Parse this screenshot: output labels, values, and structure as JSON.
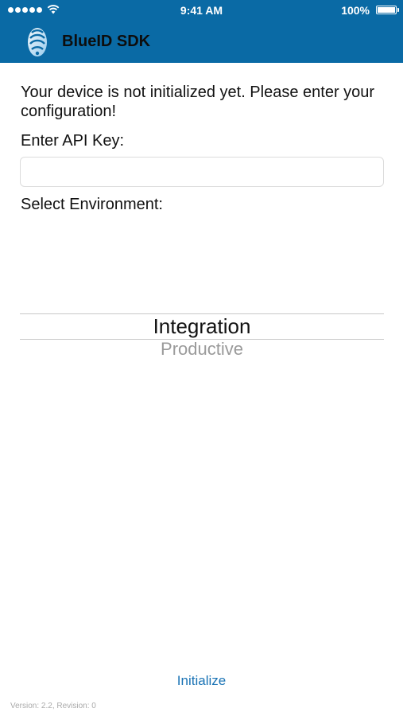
{
  "status_bar": {
    "time": "9:41 AM",
    "battery_percent": "100%"
  },
  "nav_bar": {
    "title": "BlueID SDK",
    "logo_icon": "blueid-logo-icon"
  },
  "main": {
    "message": "Your device is not initialized yet. Please enter your configuration!",
    "api_key_label": "Enter API Key:",
    "api_key_value": "",
    "environment_label": "Select Environment:",
    "environment_picker": {
      "selected": "Integration",
      "next_option": "Productive"
    },
    "initialize_label": "Initialize"
  },
  "footer": {
    "version": "Version: 2.2, Revision: 0"
  },
  "colors": {
    "header_background": "#0a6aa5",
    "link_accent": "#1a73b5"
  }
}
